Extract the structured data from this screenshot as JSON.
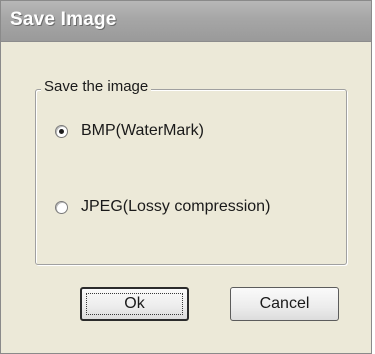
{
  "window": {
    "title": "Save Image"
  },
  "group": {
    "legend": "Save the image",
    "options": [
      {
        "label": "BMP(WaterMark)",
        "selected": true
      },
      {
        "label": "JPEG(Lossy compression)",
        "selected": false
      }
    ]
  },
  "buttons": {
    "ok_label": "Ok",
    "cancel_label": "Cancel"
  }
}
